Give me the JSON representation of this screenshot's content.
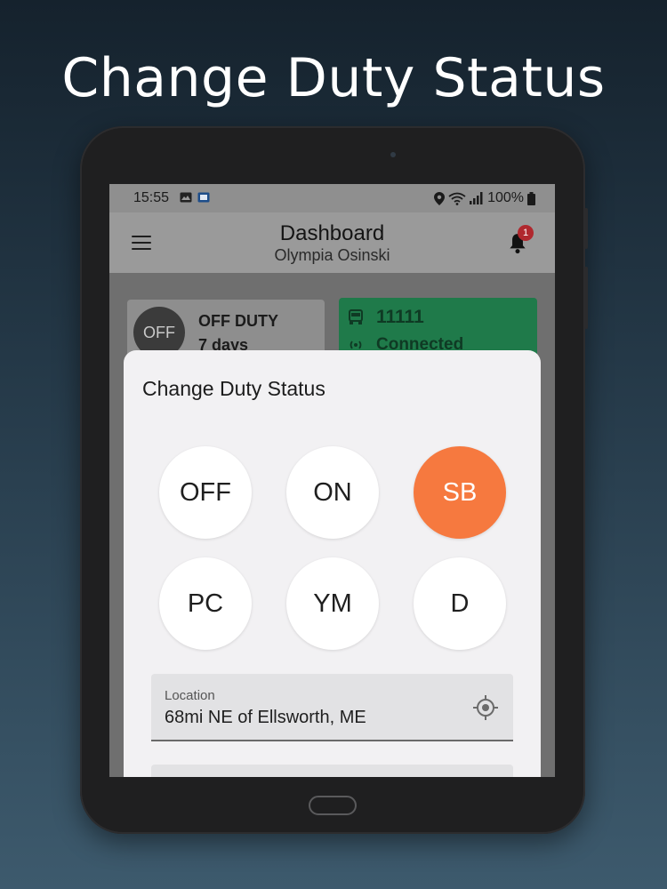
{
  "headline": "Change Duty Status",
  "statusbar": {
    "time": "15:55",
    "battery": "100%"
  },
  "appbar": {
    "title": "Dashboard",
    "subtitle": "Olympia Osinski",
    "notification_count": "1"
  },
  "duty_card": {
    "badge": "OFF",
    "status": "OFF DUTY",
    "duration": "7 days"
  },
  "vehicle_card": {
    "number": "11111",
    "connection": "Connected",
    "color": "#1f7a4a"
  },
  "sheet": {
    "title": "Change Duty Status",
    "statuses": [
      {
        "label": "OFF",
        "active": false
      },
      {
        "label": "ON",
        "active": false
      },
      {
        "label": "SB",
        "active": true
      },
      {
        "label": "PC",
        "active": false
      },
      {
        "label": "YM",
        "active": false
      },
      {
        "label": "D",
        "active": false
      }
    ],
    "active_color": "#f6793f",
    "location": {
      "label": "Location",
      "value": "68mi NE of Ellsworth, ME",
      "icon": "gps-target-icon"
    }
  }
}
